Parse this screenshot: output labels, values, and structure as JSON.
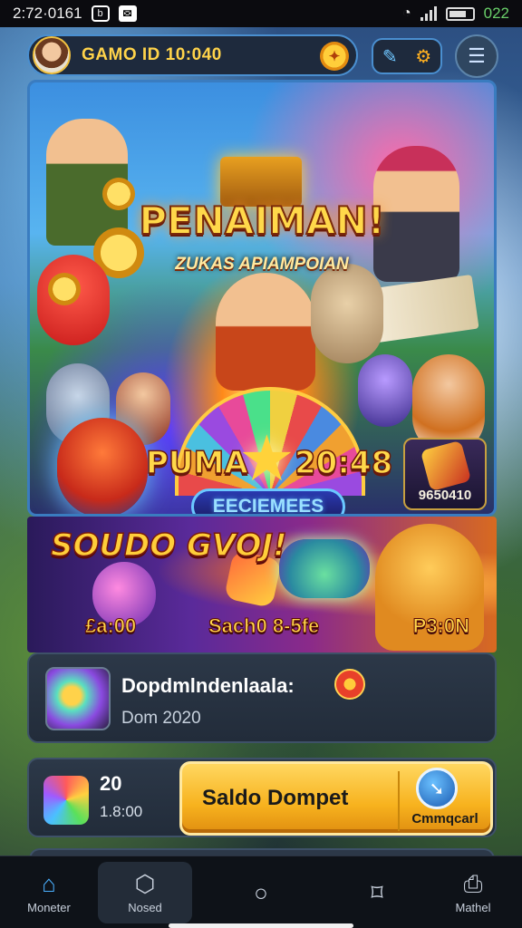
{
  "status_bar": {
    "time": "2:72·0161",
    "battery_text": "022"
  },
  "profile": {
    "name": "GAMO ID 10:040"
  },
  "hero": {
    "title": "PENAIMAN!",
    "subtitle": "ZUKAS APIAMPOIAN",
    "left_word": "PUMA",
    "right_word": "20:48",
    "ribbon": "EECIEMEES",
    "card_value": "9650410"
  },
  "promo": {
    "title": "SOUDO GVOJ!",
    "prices": [
      "£a:00",
      "Sach0 8-5fe",
      "P3:0N"
    ]
  },
  "info_card": {
    "title": "Dopdmlndenlaala:",
    "subtitle": "Dom 2020"
  },
  "wallet": {
    "amount": "20",
    "sub": "1.8:00",
    "button_label": "Saldo Dompet",
    "connect_label": "Cmmqcarl"
  },
  "bottom_nav": {
    "items": [
      {
        "label": "Moneter"
      },
      {
        "label": "Nosed"
      },
      {
        "label": ""
      },
      {
        "label": ""
      },
      {
        "label": "Mathel"
      }
    ]
  },
  "colors": {
    "accent_gold": "#f7b21e",
    "frame_blue": "#3a7cc0",
    "card_bg": "#2c3848"
  }
}
